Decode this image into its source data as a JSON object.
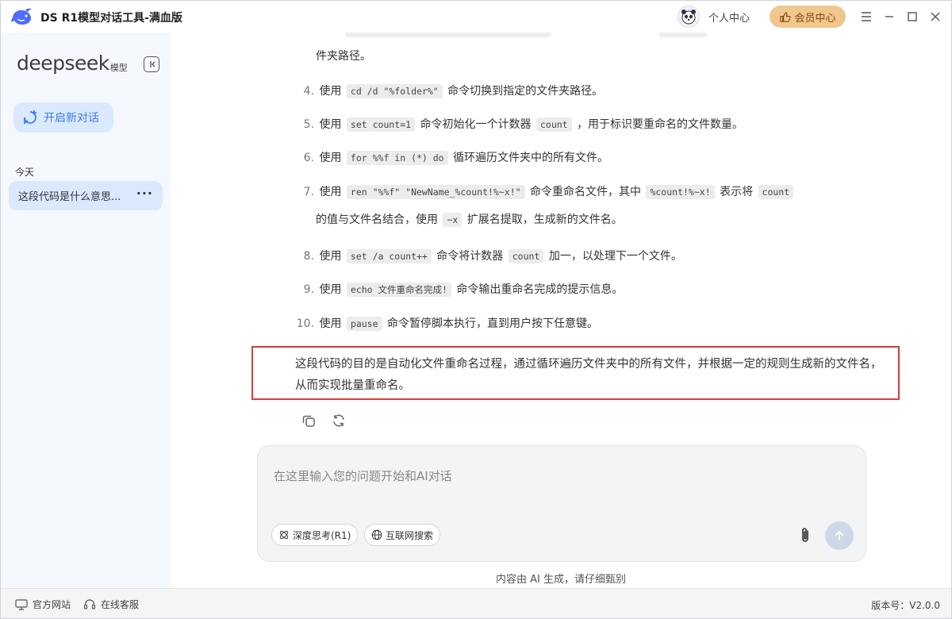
{
  "window": {
    "title": "DS R1模型对话工具-满血版",
    "profile_label": "个人中心",
    "vip_label": "会员中心"
  },
  "sidebar": {
    "brand": "deepseek",
    "brand_suffix": "模型",
    "new_chat_label": "开启新对话",
    "group_label": "今天",
    "history": [
      {
        "label": "这段代码是什么意思..."
      }
    ]
  },
  "chat": {
    "continued_text": "件夹路径。",
    "items": [
      {
        "num": "4.",
        "pre": "使用",
        "code1": "cd /d \"%folder%\"",
        "post": "命令切换到指定的文件夹路径。"
      },
      {
        "num": "5.",
        "pre": "使用",
        "code1": "set count=1",
        "mid": "命令初始化一个计数器",
        "code2": "count",
        "post": "，用于标识要重命名的文件数量。"
      },
      {
        "num": "6.",
        "pre": "使用",
        "code1": "for %%f in (*) do",
        "post": "循环遍历文件夹中的所有文件。"
      },
      {
        "num": "7.",
        "pre": "使用",
        "code1": "ren \"%%f\" \"NewName_%count!%~x!\"",
        "mid": "命令重命名文件，其中",
        "code2": "%count!%~x!",
        "mid2": "表示将",
        "code3": "count",
        "line2_pre": "的值与文件名结合，使用",
        "line2_code": "~x",
        "line2_post": "扩展名提取，生成新的文件名。"
      },
      {
        "num": "8.",
        "pre": "使用",
        "code1": "set /a count++",
        "mid": "命令将计数器",
        "code2": "count",
        "post": "加一，以处理下一个文件。"
      },
      {
        "num": "9.",
        "pre": "使用",
        "code1": "echo 文件重命名完成!",
        "post": "命令输出重命名完成的提示信息。"
      },
      {
        "num": "10.",
        "pre": "使用",
        "code1": "pause",
        "post": "命令暂停脚本执行，直到用户按下任意键。"
      }
    ],
    "summary": "这段代码的目的是自动化文件重命名过程，通过循环遍历文件夹中的所有文件，并根据一定的规则生成新的文件名，从而实现批量重命名。",
    "composer": {
      "placeholder": "在这里输入您的问题开始和AI对话",
      "deep_think_label": "深度思考(R1)",
      "web_search_label": "互联网搜索"
    },
    "disclaimer": "内容由 AI 生成，请仔细甄别"
  },
  "footer": {
    "official_site": "官方网站",
    "support": "在线客服",
    "version": "版本号：V2.0.0"
  },
  "colors": {
    "accent": "#3d7ef0",
    "sidebar_bg": "#f5f8fd",
    "highlight_border": "#d93a3a",
    "vip_bg": "#f2c78e"
  }
}
